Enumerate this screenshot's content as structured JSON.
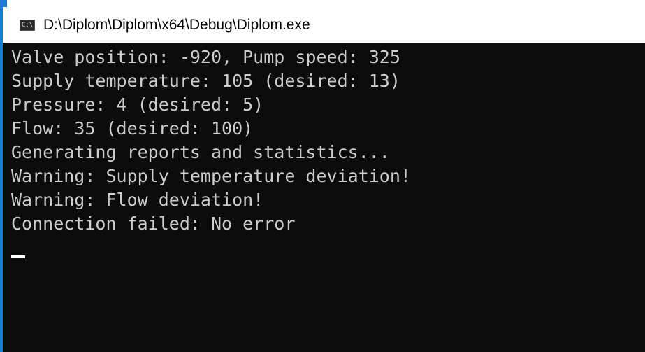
{
  "window": {
    "title": "D:\\Diplom\\Diplom\\x64\\Debug\\Diplom.exe",
    "icon": "console-app-icon",
    "icon_glyph": "C:\\"
  },
  "console": {
    "lines": [
      "Valve position: -920, Pump speed: 325",
      "Supply temperature: 105 (desired: 13)",
      "Pressure: 4 (desired: 5)",
      "Flow: 35 (desired: 100)",
      "Generating reports and statistics...",
      "Warning: Supply temperature deviation!",
      "Warning: Flow deviation!",
      "Connection failed: No error"
    ]
  },
  "colors": {
    "console_bg": "#0c0c0c",
    "console_text": "#cccccc",
    "accent": "#1f7ad6"
  }
}
